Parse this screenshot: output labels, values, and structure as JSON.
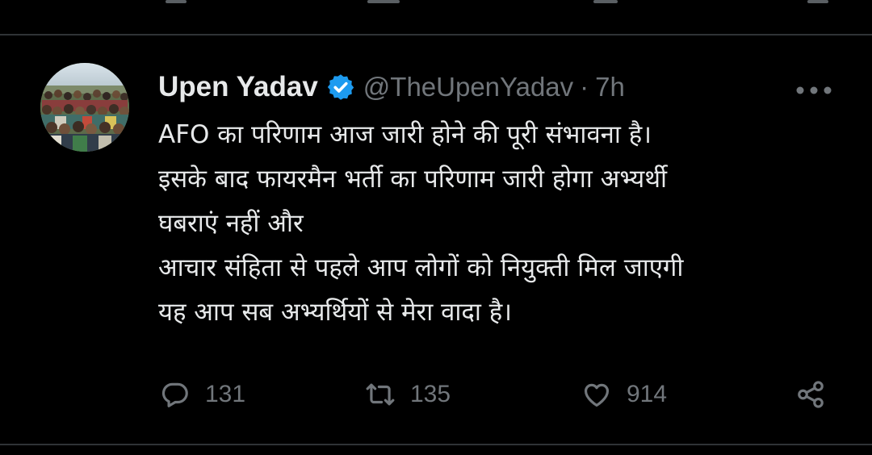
{
  "tweet": {
    "author": {
      "display_name": "Upen Yadav",
      "handle": "@TheUpenYadav",
      "verified": true,
      "verified_color": "#1d9bf0"
    },
    "separator": "·",
    "time": "7h",
    "more_icon": "more-horizontal-icon",
    "lines": [
      "AFO का परिणाम आज जारी होने की पूरी संभावना है।",
      "इसके बाद फायरमैन भर्ती का परिणाम जारी होगा अभ्यर्थी",
      "घबराएं नहीं और",
      "आचार संहिता से पहले आप लोगों को नियुक्ती मिल जाएगी",
      "यह आप सब अभ्यर्थियों से मेरा वादा है।"
    ],
    "actions": {
      "reply": {
        "icon": "reply-icon",
        "count": "131"
      },
      "retweet": {
        "icon": "retweet-icon",
        "count": "135"
      },
      "like": {
        "icon": "heart-icon",
        "count": "914"
      },
      "share": {
        "icon": "share-icon"
      }
    }
  },
  "colors": {
    "background": "#000000",
    "text": "#e7e9ea",
    "muted": "#71767b",
    "divider": "#2f3336"
  }
}
